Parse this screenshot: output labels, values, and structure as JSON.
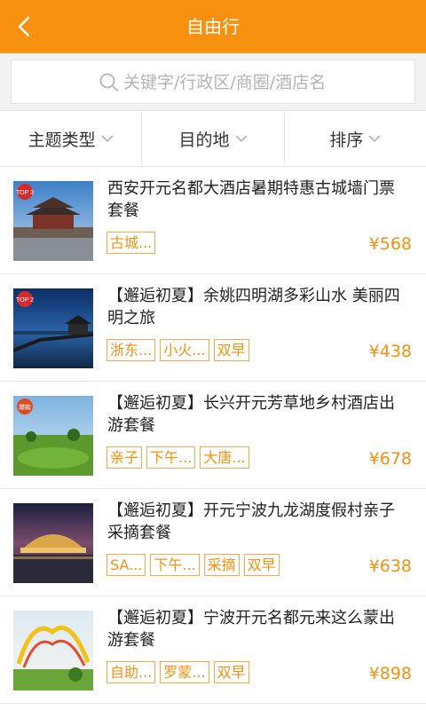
{
  "header": {
    "title": "自由行",
    "back_icon": "chevron-left-icon"
  },
  "search": {
    "placeholder": "关键字/行政区/商圈/酒店名",
    "icon": "search-icon"
  },
  "filters": [
    {
      "label": "主题类型"
    },
    {
      "label": "目的地"
    },
    {
      "label": "排序"
    }
  ],
  "colors": {
    "accent": "#f7910f",
    "tag_border": "#f7a94a"
  },
  "items": [
    {
      "badge": "TOP 3",
      "title": "西安开元名都大酒店暑期特惠古城墙门票套餐",
      "tags": [
        "古城..."
      ],
      "price": "¥568"
    },
    {
      "badge": "TOP 2",
      "title": "【邂逅初夏】余姚四明湖多彩山水 美丽四明之旅",
      "tags": [
        "浙东...",
        "小火...",
        "双早"
      ],
      "price": "¥438"
    },
    {
      "badge": "爆款",
      "title": "【邂逅初夏】长兴开元芳草地乡村酒店出游套餐",
      "tags": [
        "亲子",
        "下午...",
        "大唐..."
      ],
      "price": "¥678"
    },
    {
      "badge": "",
      "title": "【邂逅初夏】开元宁波九龙湖度假村亲子采摘套餐",
      "tags": [
        "SA...",
        "下午...",
        "采摘",
        "双早"
      ],
      "price": "¥638"
    },
    {
      "badge": "",
      "title": "【邂逅初夏】宁波开元名都元来这么蒙出游套餐",
      "tags": [
        "自助...",
        "罗蒙...",
        "双早"
      ],
      "price": "¥898"
    }
  ]
}
